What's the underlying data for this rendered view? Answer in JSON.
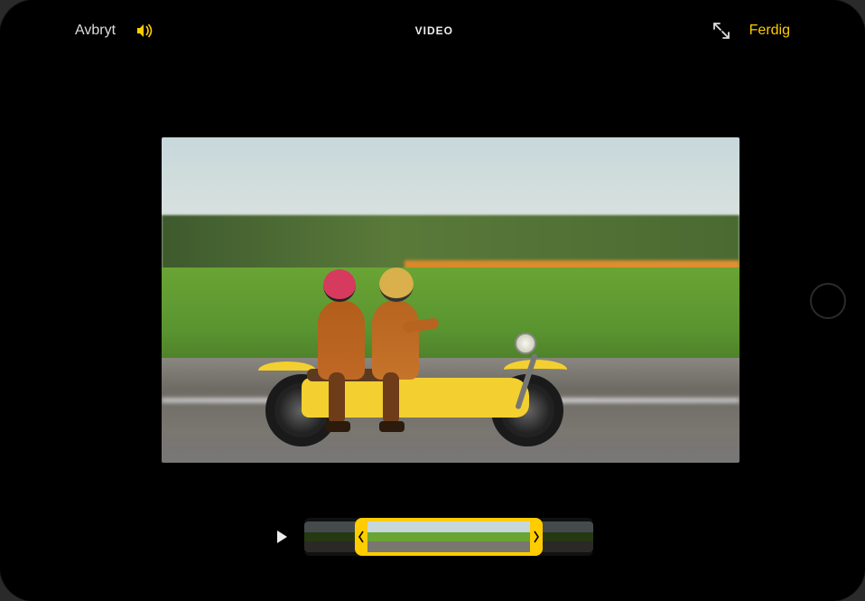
{
  "header": {
    "cancel": "Avbryt",
    "title": "VIDEO",
    "done": "Ferdig"
  },
  "icons": {
    "volume": "volume-icon",
    "fullscreen": "expand-icon",
    "play": "play-icon"
  },
  "tools": {
    "video": "video-icon",
    "adjust": "adjust-icon",
    "filters": "filters-icon",
    "crop": "crop-icon",
    "active": "video"
  },
  "colors": {
    "accent": "#ffcc00"
  },
  "timeline": {
    "thumb_count": 7,
    "trim_start_pct": 18,
    "trim_end_pct": 82
  }
}
